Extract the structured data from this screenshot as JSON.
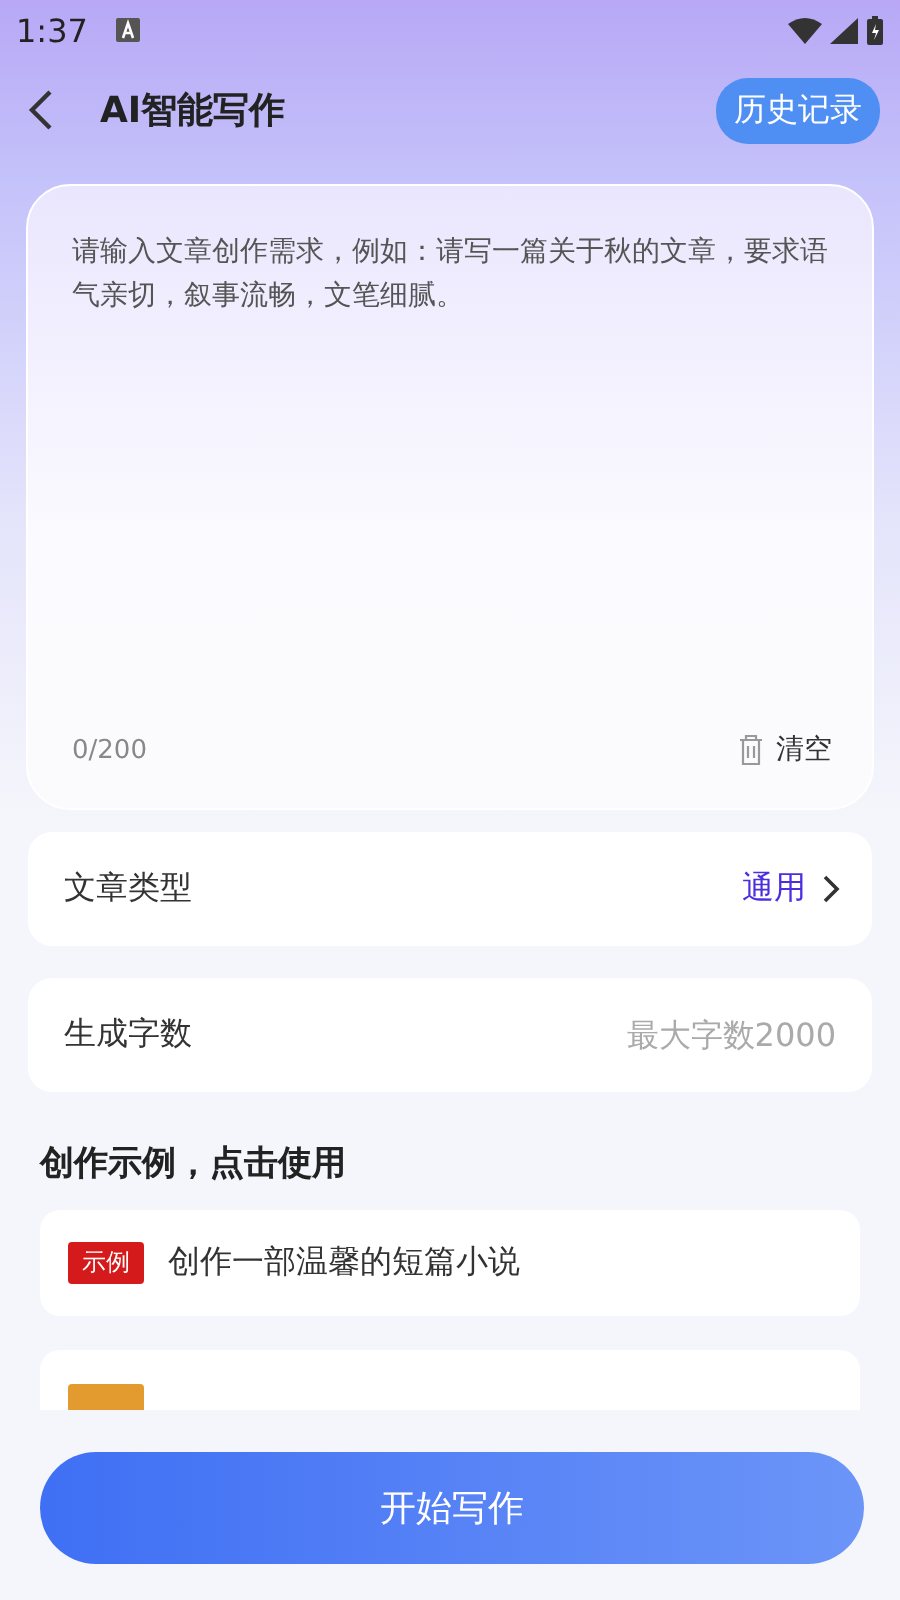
{
  "status_bar": {
    "time": "1:37"
  },
  "header": {
    "title": "AI智能写作",
    "history_button": "历史记录"
  },
  "prompt": {
    "placeholder": "请输入文章创作需求，例如：请写一篇关于秋的文章，要求语气亲切，叙事流畅，文笔细腻。",
    "counter": "0/200",
    "clear_button": "清空"
  },
  "settings": [
    {
      "kind": "select",
      "label": "文章类型",
      "value": "通用"
    },
    {
      "kind": "input",
      "label": "生成字数",
      "placeholder": "最大字数2000"
    }
  ],
  "examples_title": "创作示例，点击使用",
  "examples": [
    {
      "tag": "示例",
      "text": "创作一部温馨的短篇小说",
      "color": "#d51a1c"
    },
    {
      "color": "#e39a2e"
    }
  ],
  "start_button": "开始写作"
}
